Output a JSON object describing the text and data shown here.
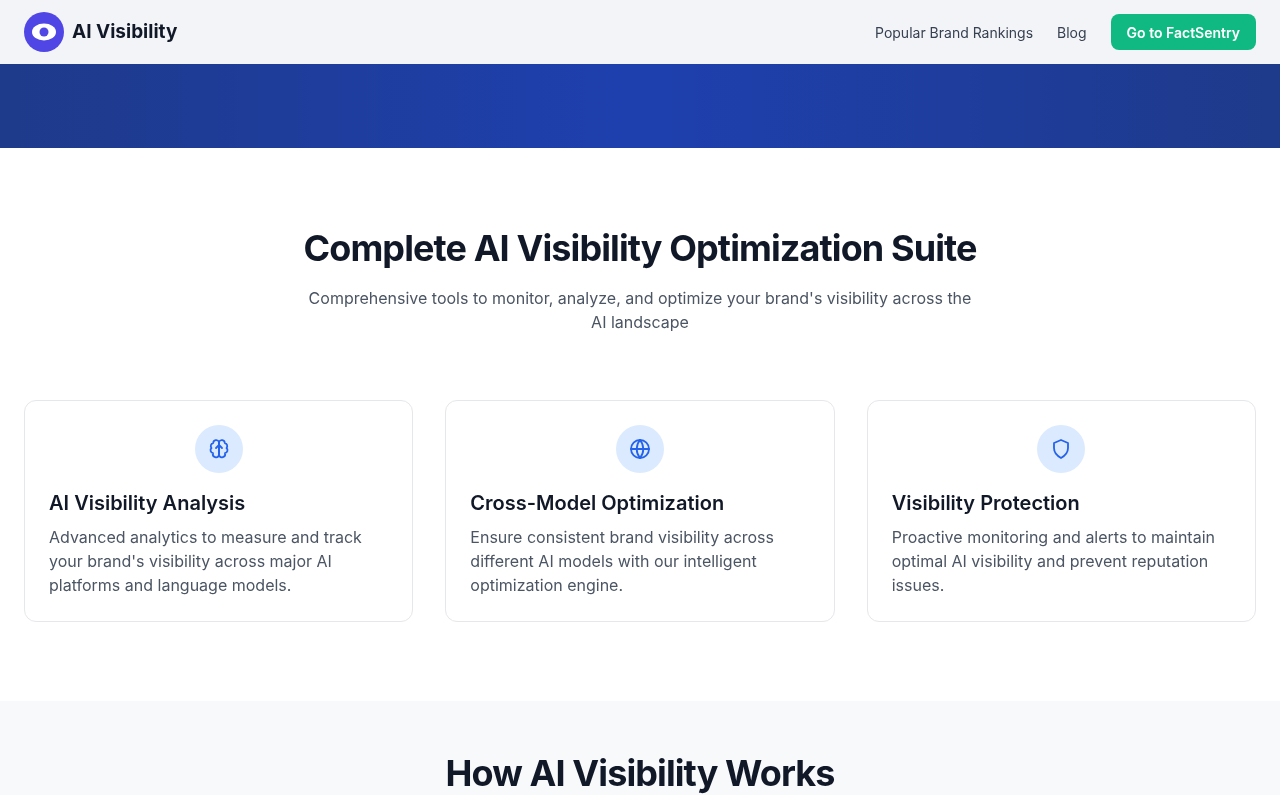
{
  "header": {
    "logo_text": "AI Visibility",
    "nav": [
      "Popular Brand Rankings",
      "Blog"
    ],
    "cta": "Go to FactSentry"
  },
  "features": {
    "title": "Complete AI Visibility Optimization Suite",
    "subtitle": "Comprehensive tools to monitor, analyze, and optimize your brand's visibility across the AI landscape",
    "cards": [
      {
        "kind": "brain",
        "title": "AI Visibility Analysis",
        "text": "Advanced analytics to measure and track your brand's visibility across major AI platforms and language models."
      },
      {
        "kind": "globe",
        "title": "Cross-Model Optimization",
        "text": "Ensure consistent brand visibility across different AI models with our intelligent optimization engine."
      },
      {
        "kind": "shield",
        "title": "Visibility Protection",
        "text": "Proactive monitoring and alerts to maintain optimal AI visibility and prevent reputation issues."
      }
    ]
  },
  "how": {
    "title": "How AI Visibility Works"
  }
}
